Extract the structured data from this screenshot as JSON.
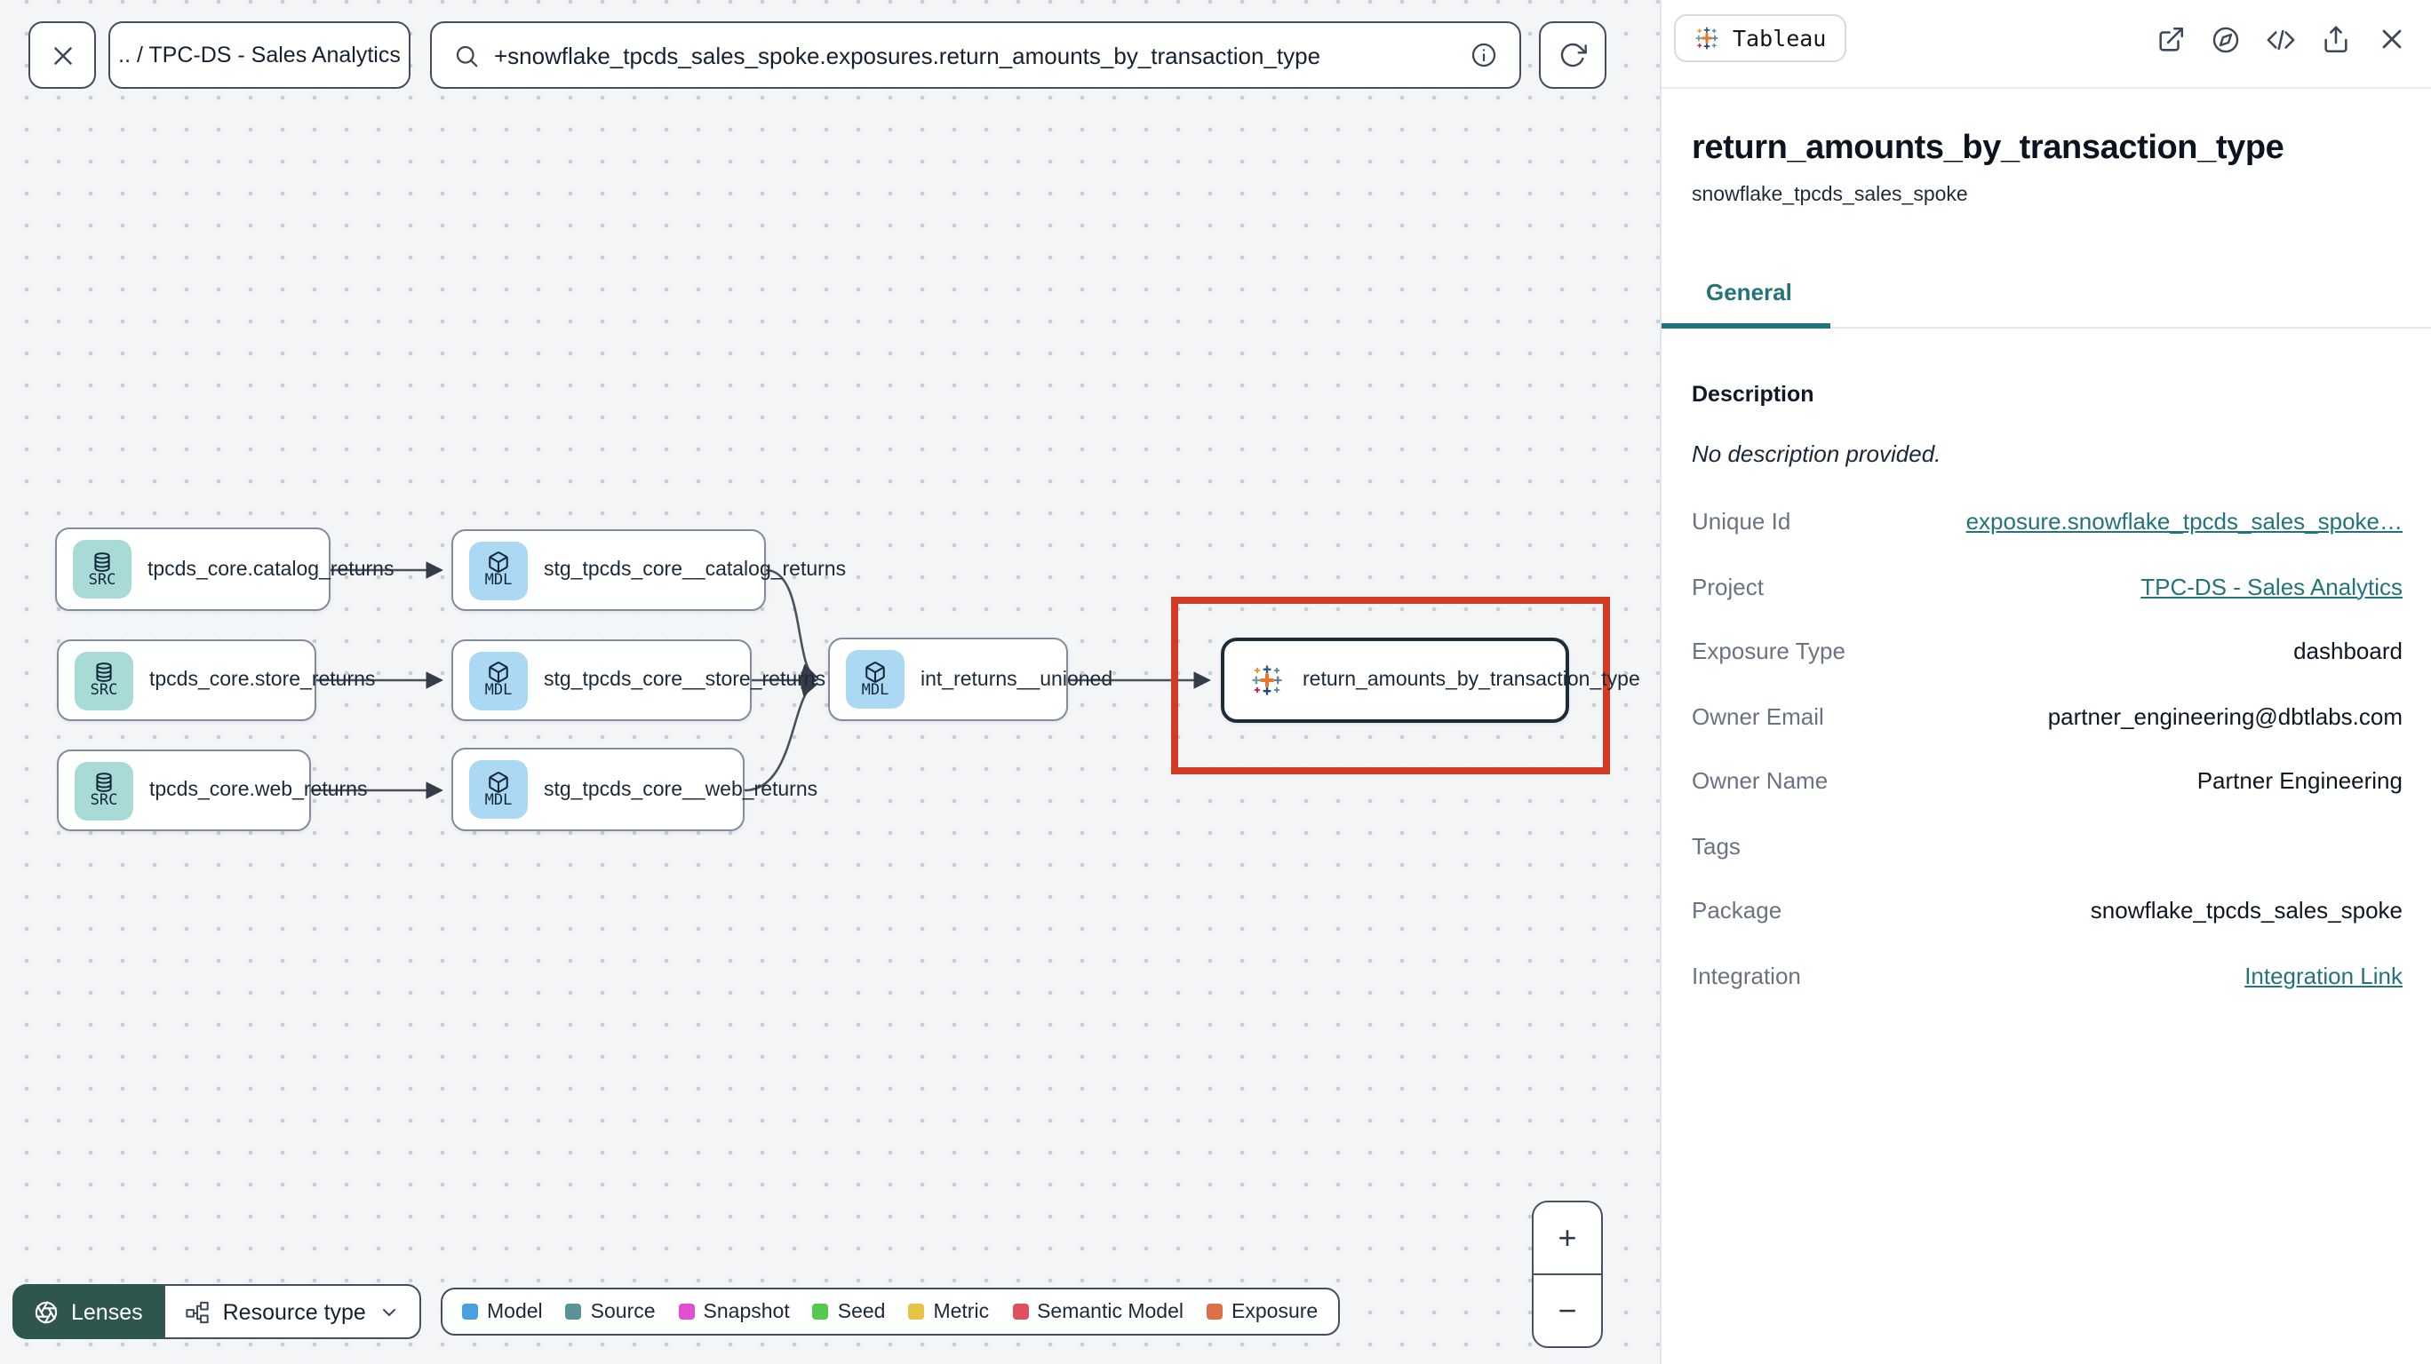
{
  "topbar": {
    "breadcrumb": ".. / TPC-DS - Sales Analytics",
    "search_value": "+snowflake_tpcds_sales_spoke.exposures.return_amounts_by_transaction_type"
  },
  "graph": {
    "nodes": [
      {
        "badge": "SRC",
        "label": "tpcds_core.catalog_returns",
        "type": "source"
      },
      {
        "badge": "SRC",
        "label": "tpcds_core.store_returns",
        "type": "source"
      },
      {
        "badge": "SRC",
        "label": "tpcds_core.web_returns",
        "type": "source"
      },
      {
        "badge": "MDL",
        "label": "stg_tpcds_core__catalog_returns",
        "type": "model"
      },
      {
        "badge": "MDL",
        "label": "stg_tpcds_core__store_returns",
        "type": "model"
      },
      {
        "badge": "MDL",
        "label": "stg_tpcds_core__web_returns",
        "type": "model"
      },
      {
        "badge": "MDL",
        "label": "int_returns__unioned",
        "type": "model"
      },
      {
        "badge": "",
        "label": "return_amounts_by_transaction_type",
        "type": "exposure"
      }
    ]
  },
  "toolbar": {
    "lenses_label": "Lenses",
    "resource_type_label": "Resource type"
  },
  "legend": {
    "items": [
      {
        "label": "Model",
        "color": "#4a9fe0"
      },
      {
        "label": "Source",
        "color": "#579399"
      },
      {
        "label": "Snapshot",
        "color": "#e050ce"
      },
      {
        "label": "Seed",
        "color": "#53c94e"
      },
      {
        "label": "Metric",
        "color": "#e7c244"
      },
      {
        "label": "Semantic Model",
        "color": "#e0515f"
      },
      {
        "label": "Exposure",
        "color": "#dd7049"
      }
    ]
  },
  "zoom_controls": {
    "zoom_in": "+",
    "zoom_out": "−"
  },
  "panel": {
    "integration_badge": "Tableau",
    "title": "return_amounts_by_transaction_type",
    "subtitle": "snowflake_tpcds_sales_spoke",
    "tab_general": "General",
    "description_heading": "Description",
    "description_empty": "No description provided.",
    "fields": [
      {
        "label": "Unique Id",
        "value": "exposure.snowflake_tpcds_sales_spoke…",
        "link": true
      },
      {
        "label": "Project",
        "value": "TPC-DS - Sales Analytics",
        "link": true
      },
      {
        "label": "Exposure Type",
        "value": "dashboard",
        "link": false
      },
      {
        "label": "Owner Email",
        "value": "partner_engineering@dbtlabs.com",
        "link": false
      },
      {
        "label": "Owner Name",
        "value": "Partner Engineering",
        "link": false
      },
      {
        "label": "Tags",
        "value": "",
        "link": false
      },
      {
        "label": "Package",
        "value": "snowflake_tpcds_sales_spoke",
        "link": false
      },
      {
        "label": "Integration",
        "value": "Integration Link",
        "link": true
      }
    ]
  },
  "colors": {
    "accent_teal": "#23747a",
    "highlight_red": "#d23c24",
    "lenses_green": "#2e564f",
    "source_tile": "#a8dbd6",
    "model_tile": "#abd9f3"
  }
}
